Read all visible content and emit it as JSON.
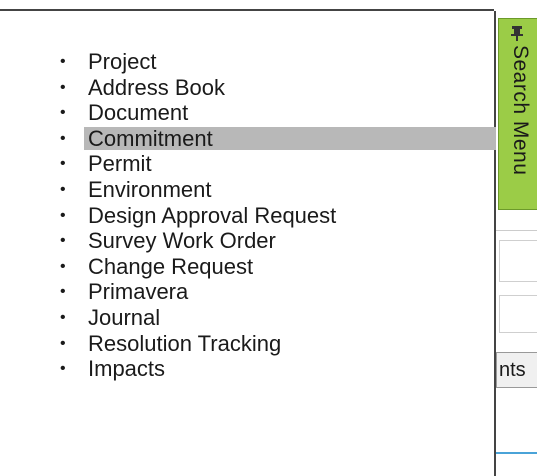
{
  "menu": {
    "items": [
      {
        "label": "Project"
      },
      {
        "label": "Address Book"
      },
      {
        "label": "Document"
      },
      {
        "label": "Commitment",
        "highlighted": true
      },
      {
        "label": "Permit"
      },
      {
        "label": "Environment"
      },
      {
        "label": "Design Approval Request"
      },
      {
        "label": "Survey Work Order"
      },
      {
        "label": "Change Request"
      },
      {
        "label": "Primavera"
      },
      {
        "label": "Journal"
      },
      {
        "label": "Resolution Tracking"
      },
      {
        "label": "Impacts"
      }
    ],
    "bullet": "•"
  },
  "search_tab": {
    "label": "Search Menu",
    "pin_icon": "pin-icon"
  },
  "partial_button": {
    "label": "nts"
  },
  "colors": {
    "tab_green": "#9bcc47",
    "highlight": "#b8b8b8",
    "accent_blue": "#4aa3d8"
  }
}
